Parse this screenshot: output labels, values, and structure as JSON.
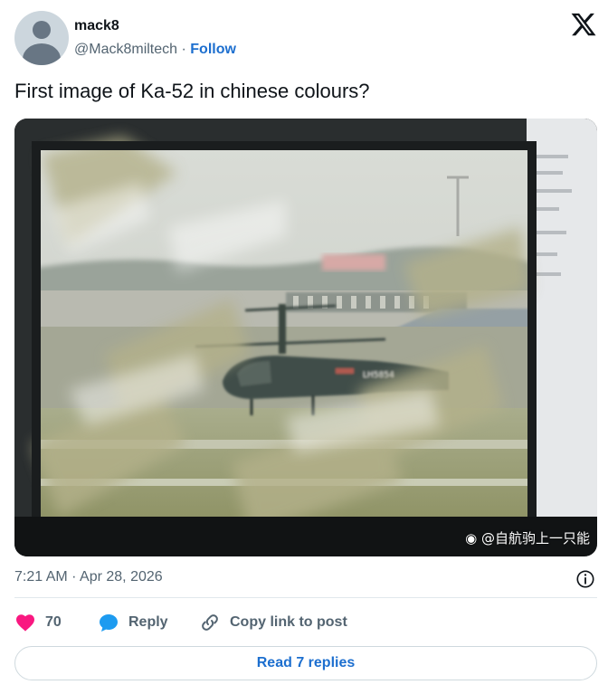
{
  "author": {
    "name": "mack8",
    "handle": "@Mack8miltech",
    "separator": "·",
    "follow_label": "Follow"
  },
  "brand_icon": "x-logo-icon",
  "tweet": {
    "text": "First image of Ka-52 in chinese colours?",
    "media": {
      "description_icon": "photo",
      "tail_marking": "LH5854",
      "watermark_icon": "weibo-icon",
      "watermark_text": "@自航驹上一只能"
    },
    "timestamp": "7:21 AM · Apr 28, 2026"
  },
  "actions": {
    "like_count": "70",
    "reply_label": "Reply",
    "copy_label": "Copy link to post"
  },
  "read_replies_label": "Read 7 replies",
  "colors": {
    "accent": "#1d6fcf",
    "like": "#f91880",
    "reply": "#1d9bf0",
    "muted": "#536471"
  }
}
